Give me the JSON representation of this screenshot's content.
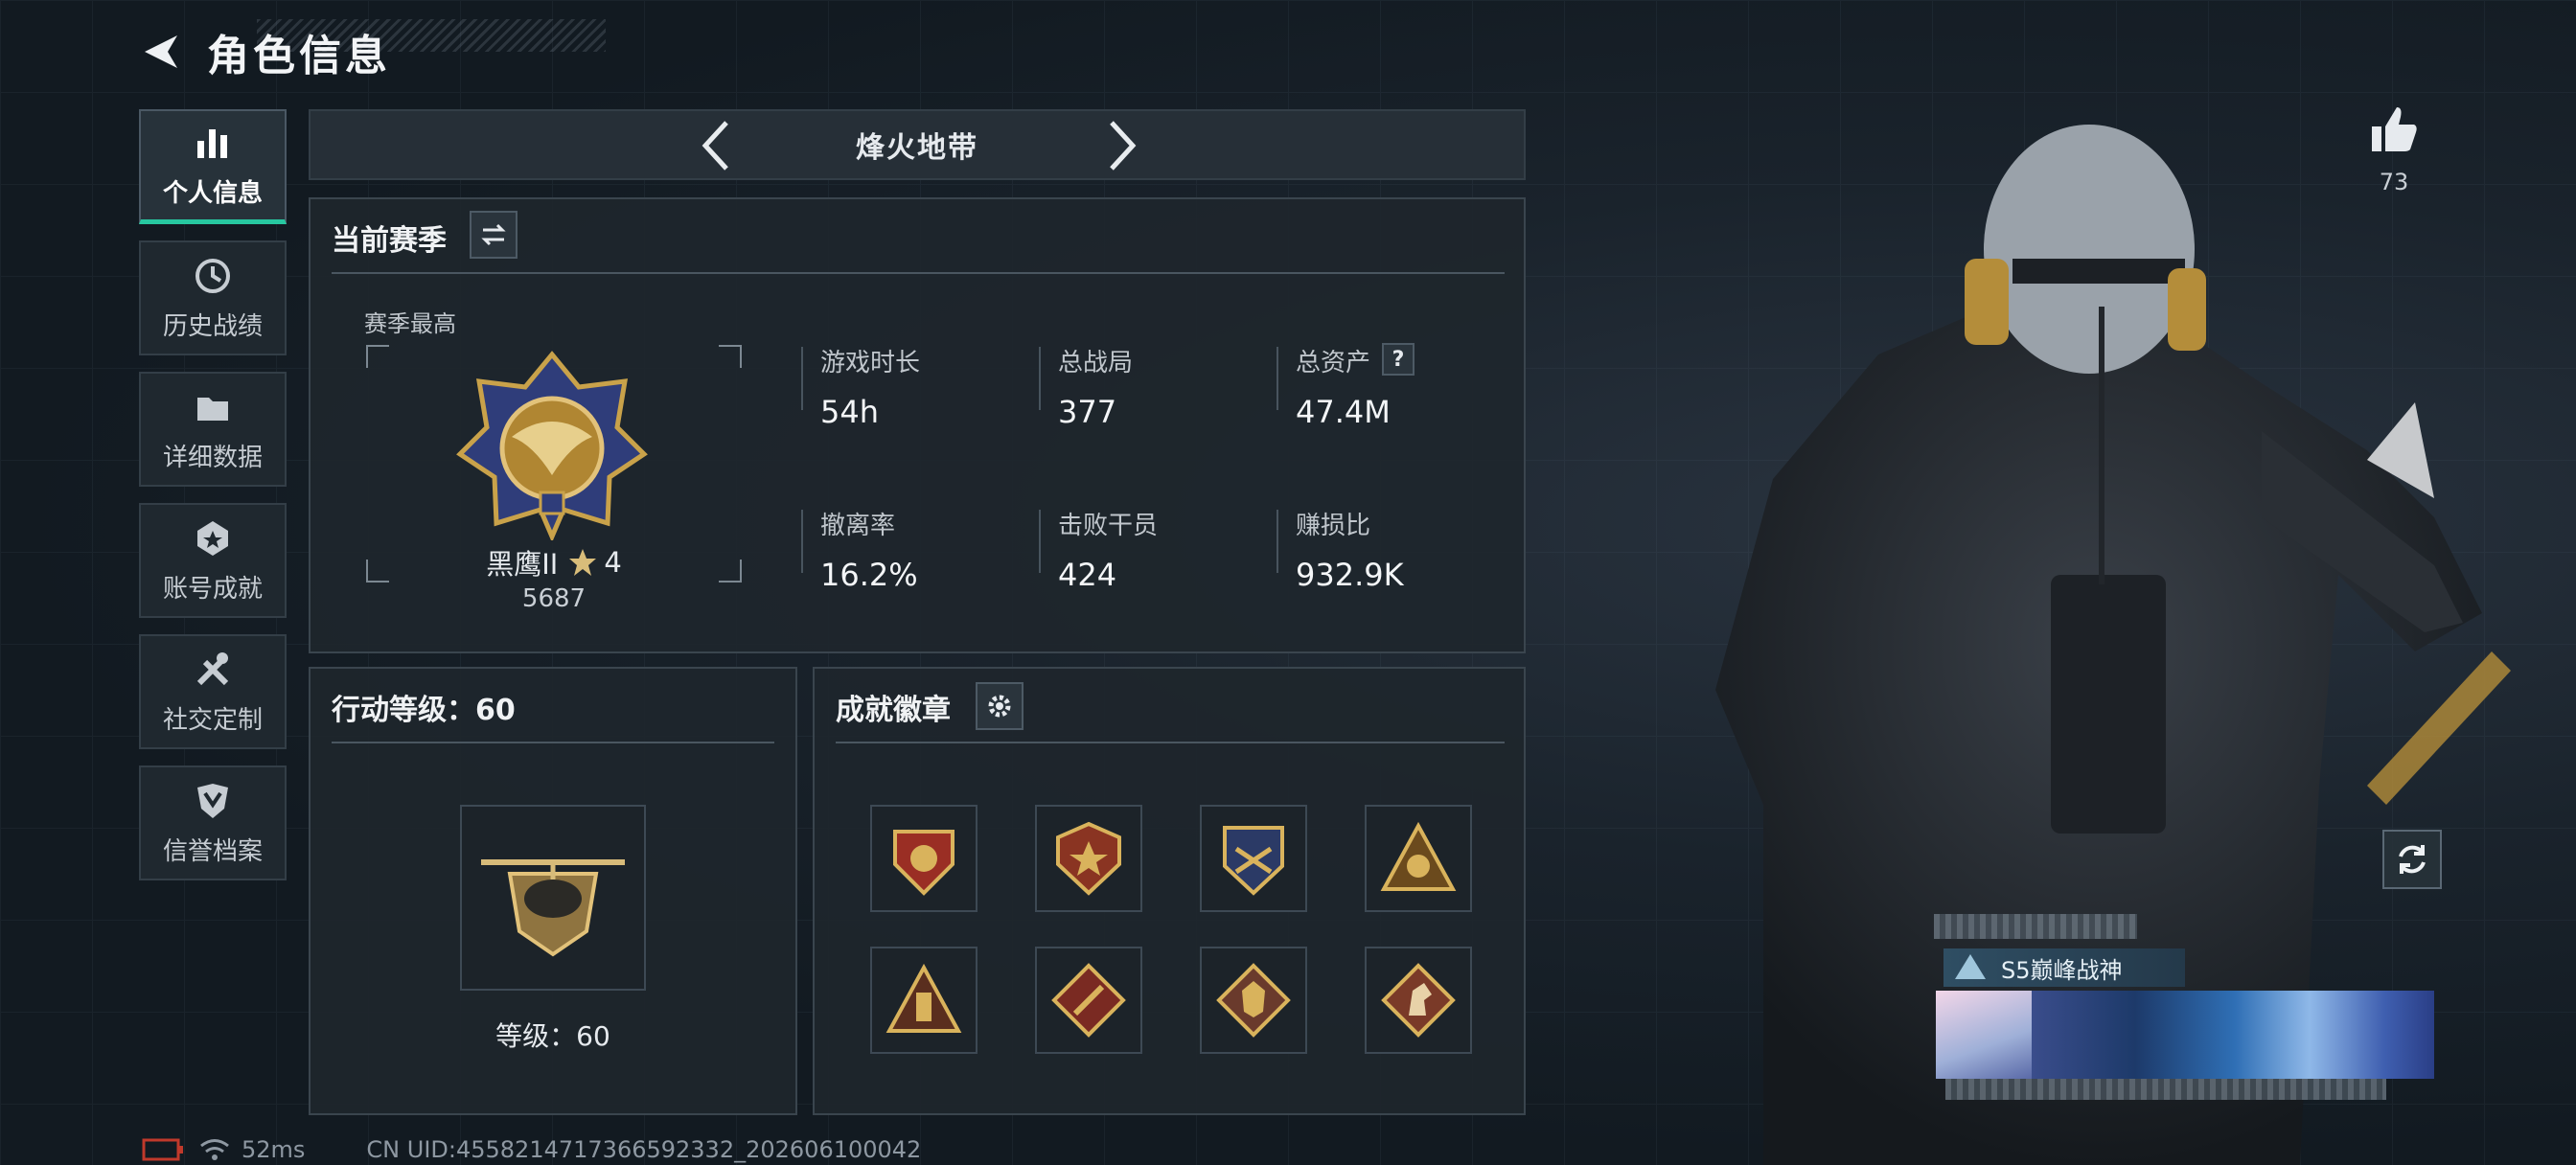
{
  "header": {
    "title": "角色信息"
  },
  "sidebar": {
    "items": [
      {
        "label": "个人信息",
        "icon": "bar-chart-icon",
        "active": true
      },
      {
        "label": "历史战绩",
        "icon": "history-clock-icon"
      },
      {
        "label": "详细数据",
        "icon": "folder-icon"
      },
      {
        "label": "账号成就",
        "icon": "medal-icon"
      },
      {
        "label": "社交定制",
        "icon": "tools-icon"
      },
      {
        "label": "信誉档案",
        "icon": "shield-badge-icon"
      }
    ]
  },
  "mode": {
    "title": "烽火地带"
  },
  "season": {
    "title": "当前赛季",
    "best_label": "赛季最高",
    "rank_name": "黑鹰II",
    "rank_stars": "4",
    "rank_score": "5687",
    "stats": [
      {
        "label": "游戏时长",
        "value": "54h"
      },
      {
        "label": "总战局",
        "value": "377"
      },
      {
        "label": "总资产",
        "value": "47.4M",
        "help": "?"
      },
      {
        "label": "撤离率",
        "value": "16.2%"
      },
      {
        "label": "击败干员",
        "value": "424"
      },
      {
        "label": "赚损比",
        "value": "932.9K"
      }
    ]
  },
  "action_level": {
    "title": "行动等级：60",
    "level_text": "等级：60"
  },
  "achievements": {
    "title": "成就徽章",
    "badge_count": 8
  },
  "likes": {
    "count": "73"
  },
  "player_card": {
    "rank_tag": "S5巅峰战神"
  },
  "footer": {
    "ping": "52ms",
    "uid": "CN UID:4558214717366592332_202606100042"
  },
  "colors": {
    "accent": "#27c7a0",
    "gold": "#c9a24a",
    "panel": "#1e262d"
  }
}
